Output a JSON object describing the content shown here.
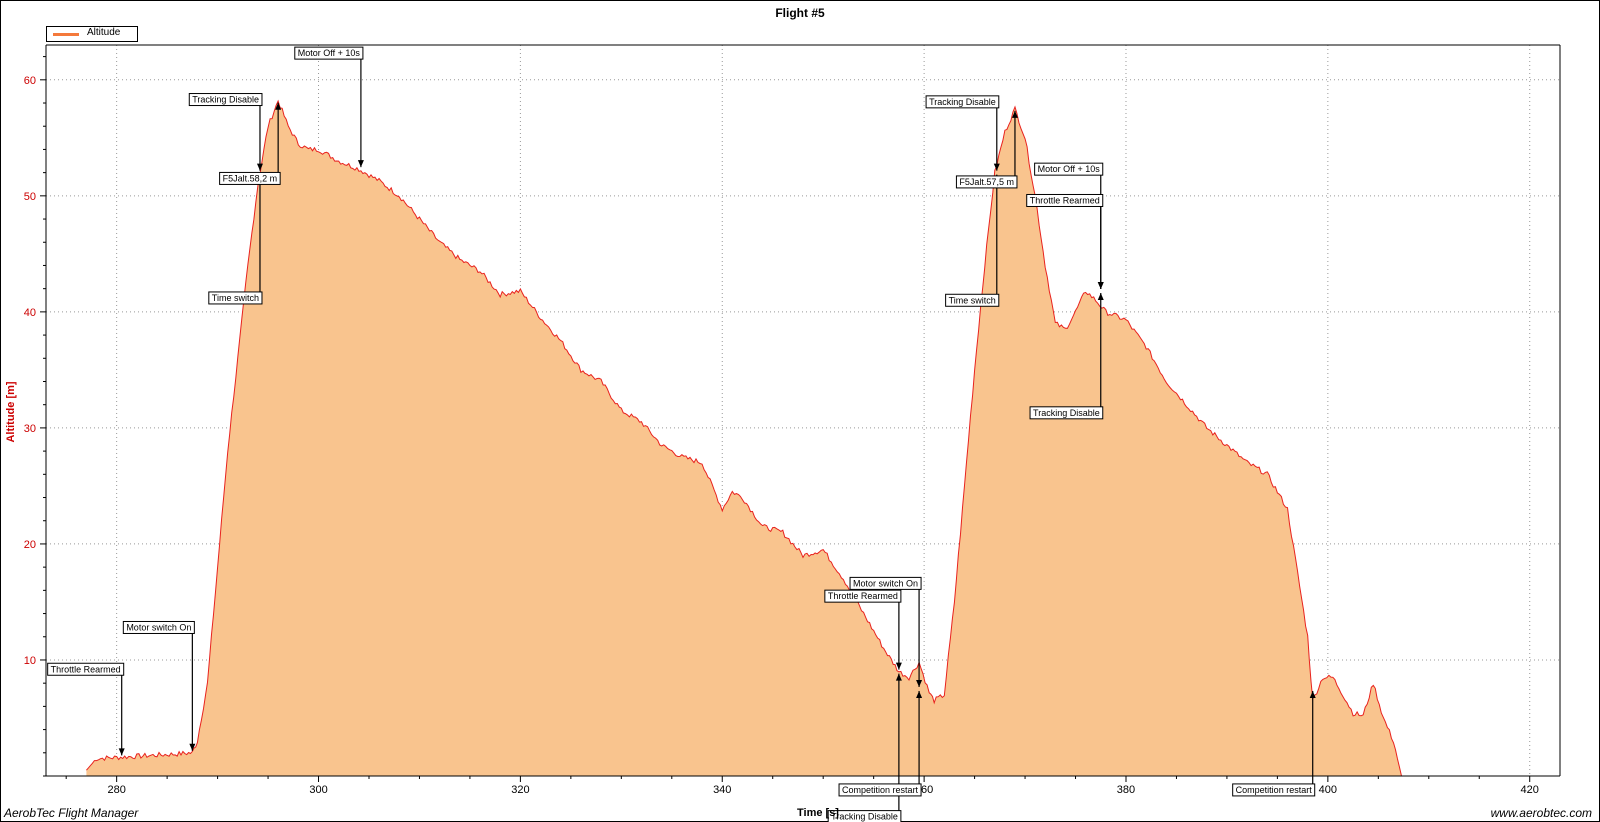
{
  "footer": {
    "app_name": "AerobTec Flight Manager",
    "website": "www.aerobtec.com"
  },
  "colors": {
    "fill": "#f9c48e",
    "line": "#e8221e",
    "axis_label": "#cc0000",
    "legend_swatch": "#f4793b"
  },
  "chart_data": {
    "type": "area",
    "title": "Flight #5",
    "xlabel": "Time [s]",
    "ylabel": "Altitude [m]",
    "xlim": [
      273,
      423
    ],
    "ylim": [
      0,
      63
    ],
    "xticks": [
      280,
      300,
      320,
      340,
      360,
      380,
      400,
      420
    ],
    "yticks": [
      10,
      20,
      30,
      40,
      50,
      60
    ],
    "grid": true,
    "legend": {
      "position": "top-left",
      "entries": [
        "Altitude"
      ]
    },
    "series": [
      {
        "name": "Altitude",
        "x": [
          277,
          278,
          280,
          282,
          284,
          286,
          287.5,
          288,
          289,
          290,
          291,
          292,
          293,
          294,
          295,
          296,
          297,
          298,
          299,
          300,
          302,
          304,
          306,
          308,
          310,
          312,
          314,
          316,
          318,
          320,
          322,
          324,
          326,
          328,
          330,
          332,
          334,
          336,
          338,
          340,
          341,
          342,
          344,
          346,
          348,
          350,
          352,
          354,
          356,
          357.5,
          358.5,
          359.5,
          360.5,
          361,
          362,
          363,
          364,
          365,
          366,
          367,
          368,
          369,
          370,
          371,
          372,
          373,
          374,
          375,
          376,
          377,
          378,
          380,
          382,
          384,
          386,
          388,
          390,
          392,
          394,
          396,
          398,
          398.5,
          399.5,
          400.5,
          401.5,
          402.5,
          403.5,
          404.5,
          405.5,
          406.5,
          407.3
        ],
        "values": [
          0.5,
          1.5,
          1.6,
          1.7,
          1.8,
          1.9,
          2.0,
          3,
          8,
          18,
          28,
          36,
          44,
          51,
          56,
          58.2,
          56,
          54.5,
          54,
          54,
          53,
          52.3,
          51.3,
          50,
          48,
          46,
          44.5,
          43.5,
          41.5,
          41.8,
          39.5,
          37.5,
          35,
          34,
          31.5,
          30.5,
          28.5,
          27.5,
          27,
          23,
          24.5,
          24,
          21.5,
          21,
          19,
          19.5,
          17,
          14,
          11,
          9,
          8.5,
          9.8,
          7.2,
          6.5,
          7,
          15,
          25,
          35,
          44,
          52,
          55.5,
          57.5,
          55,
          50,
          44,
          39,
          38.5,
          40,
          41.8,
          41,
          40,
          39.3,
          37,
          34,
          32,
          30,
          28.5,
          27,
          26,
          23,
          12,
          6.5,
          8.5,
          8.5,
          7,
          5.4,
          5.2,
          8,
          5,
          3,
          0
        ]
      }
    ],
    "annotations": [
      {
        "label": "Throttle Rearmed",
        "x": 280.5,
        "y": 1.6,
        "text_y": 9.2
      },
      {
        "label": "Motor switch On",
        "x": 287.5,
        "y": 2.0,
        "text_y": 12.8
      },
      {
        "label": "Tracking Disable",
        "x": 294.2,
        "y": 52,
        "text_y": 58.3
      },
      {
        "label": "Time switch",
        "x": 294.2,
        "y": 52,
        "text_y": 41.2
      },
      {
        "label": "F5Jalt.58,2 m",
        "x": 296,
        "y": 58.2,
        "text_y": 51.5
      },
      {
        "label": "Motor Off + 10s",
        "x": 304.2,
        "y": 52.3,
        "text_y": 62.3
      },
      {
        "label": "Throttle Rearmed",
        "x": 357.5,
        "y": 9,
        "text_y": 15.5
      },
      {
        "label": "Tracking Disable",
        "x": 357.5,
        "y": 9,
        "text_y": -3.5
      },
      {
        "label": "Motor switch On",
        "x": 359.5,
        "y": 7.5,
        "text_y": 16.6
      },
      {
        "label": "Competition restart",
        "x": 359.5,
        "y": 7.5,
        "text_y": -1.2
      },
      {
        "label": "Tracking Disable",
        "x": 367.2,
        "y": 52,
        "text_y": 58.1
      },
      {
        "label": "Time switch",
        "x": 367.2,
        "y": 52,
        "text_y": 41.0
      },
      {
        "label": "F5Jalt.57,5 m",
        "x": 369,
        "y": 57.5,
        "text_y": 51.2
      },
      {
        "label": "Motor Off + 10s",
        "x": 377.5,
        "y": 41.8,
        "text_y": 52.3
      },
      {
        "label": "Throttle Rearmed",
        "x": 377.5,
        "y": 41.8,
        "text_y": 49.6
      },
      {
        "label": "Tracking Disable",
        "x": 377.5,
        "y": 41.8,
        "text_y": 31.3
      },
      {
        "label": "Competition restart",
        "x": 398.5,
        "y": 7.5,
        "text_y": -1.2
      }
    ]
  }
}
